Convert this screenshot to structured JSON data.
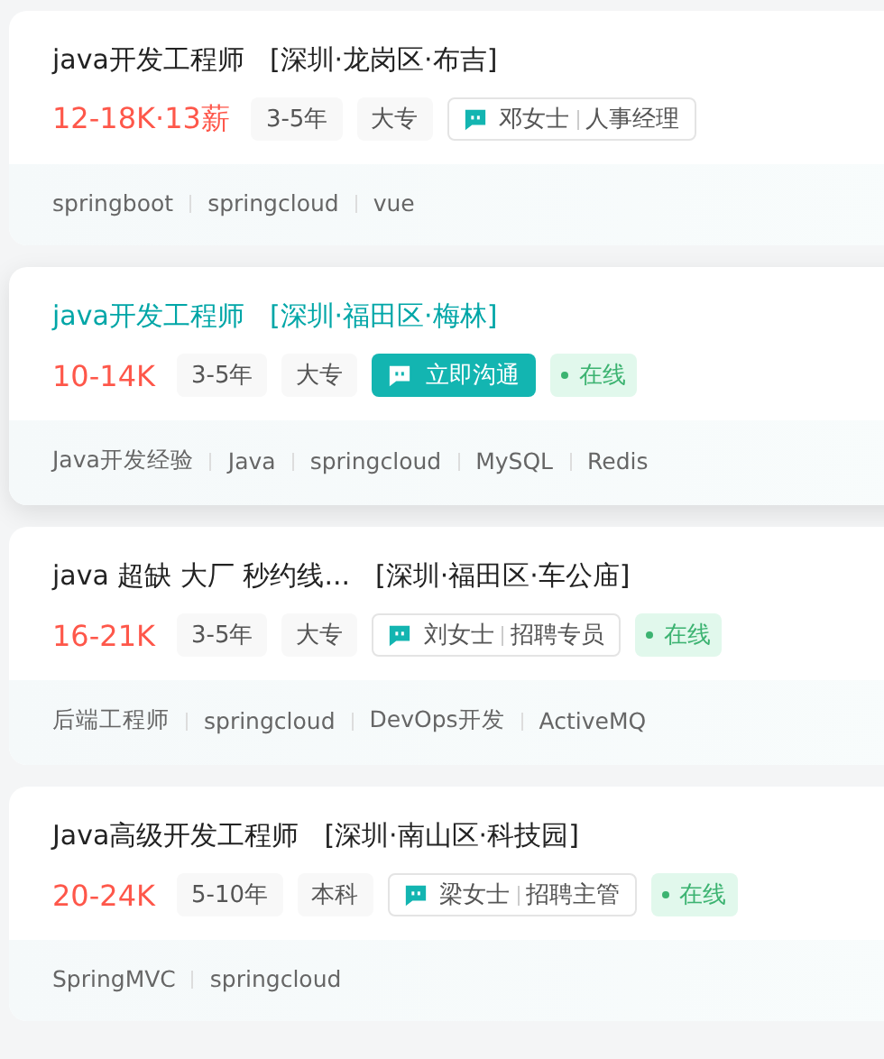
{
  "jobs": [
    {
      "title": "java开发工程师",
      "location": "[深圳·龙岗区·布吉]",
      "highlighted": false,
      "salary": "12-18K·13薪",
      "requirements": [
        "3-5年",
        "大专"
      ],
      "contact": {
        "kind": "recruiter",
        "name": "邓女士",
        "role": "人事经理"
      },
      "tags": [
        "springboot",
        "springcloud",
        "vue"
      ]
    },
    {
      "title": "java开发工程师",
      "location": "[深圳·福田区·梅林]",
      "highlighted": true,
      "salary": "10-14K",
      "requirements": [
        "3-5年",
        "大专"
      ],
      "contact": {
        "kind": "chat",
        "label": "立即沟通"
      },
      "online": "在线",
      "tags": [
        "Java开发经验",
        "Java",
        "springcloud",
        "MySQL",
        "Redis"
      ]
    },
    {
      "title": "java 超缺 大厂 秒约线...",
      "location": "[深圳·福田区·车公庙]",
      "highlighted": false,
      "salary": "16-21K",
      "requirements": [
        "3-5年",
        "大专"
      ],
      "contact": {
        "kind": "recruiter",
        "name": "刘女士",
        "role": "招聘专员"
      },
      "online": "在线",
      "tags": [
        "后端工程师",
        "springcloud",
        "DevOps开发",
        "ActiveMQ"
      ]
    },
    {
      "title": "Java高级开发工程师",
      "location": "[深圳·南山区·科技园]",
      "highlighted": false,
      "salary": "20-24K",
      "requirements": [
        "5-10年",
        "本科"
      ],
      "contact": {
        "kind": "recruiter",
        "name": "梁女士",
        "role": "招聘主管"
      },
      "online": "在线",
      "tags": [
        "SpringMVC",
        "springcloud"
      ]
    }
  ]
}
